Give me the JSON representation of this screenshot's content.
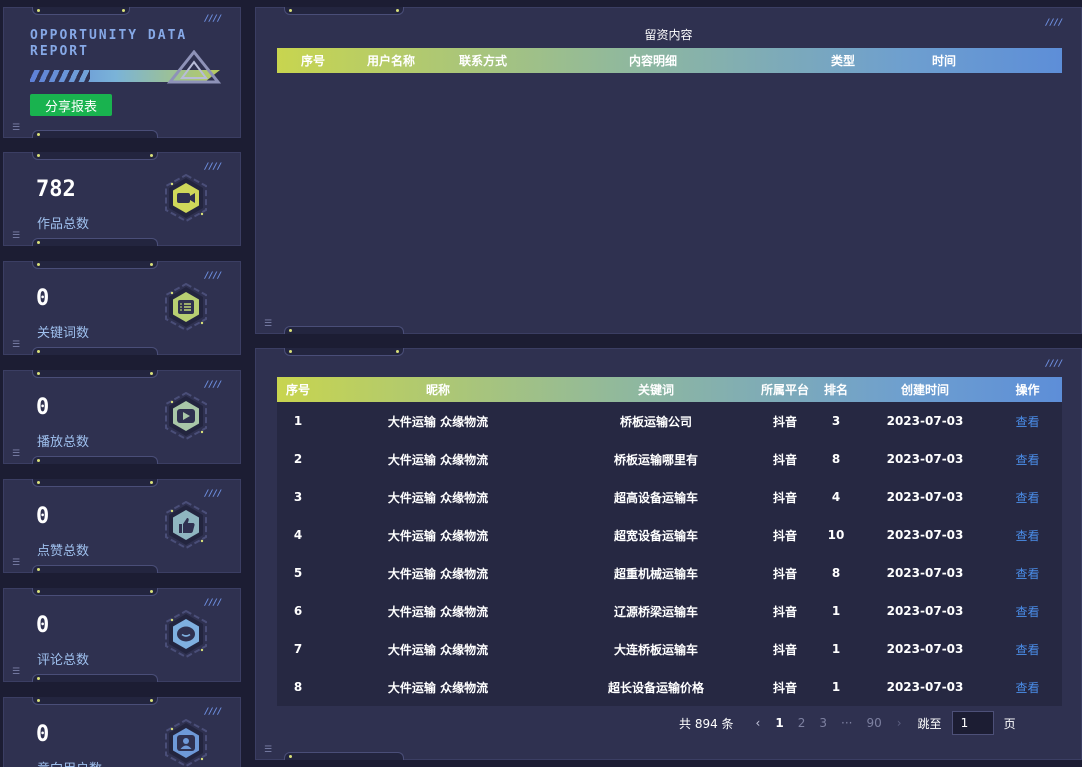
{
  "logo": {
    "line1": "OPPORTUNITY DATA",
    "line2": "REPORT",
    "share_label": "分享报表"
  },
  "stats": [
    {
      "value": "782",
      "label": "作品总数",
      "icon": "video-camera-icon"
    },
    {
      "value": "0",
      "label": "关键词数",
      "icon": "list-icon"
    },
    {
      "value": "0",
      "label": "播放总数",
      "icon": "play-icon"
    },
    {
      "value": "0",
      "label": "点赞总数",
      "icon": "thumbs-up-icon"
    },
    {
      "value": "0",
      "label": "评论总数",
      "icon": "comment-icon"
    },
    {
      "value": "0",
      "label": "意向用户数",
      "icon": "user-icon"
    }
  ],
  "leads_table": {
    "title": "留资内容",
    "columns": [
      "序号",
      "用户名称",
      "联系方式",
      "内容明细",
      "类型",
      "时间"
    ],
    "rows": []
  },
  "keywords_table": {
    "columns": [
      "序号",
      "昵称",
      "关键词",
      "所属平台",
      "排名",
      "创建时间",
      "操作"
    ],
    "rows": [
      {
        "index": "1",
        "nickname": "大件运输 众缘物流",
        "keyword": "桥板运输公司",
        "platform": "抖音",
        "rank": "3",
        "date": "2023-07-03",
        "action": "查看"
      },
      {
        "index": "2",
        "nickname": "大件运输 众缘物流",
        "keyword": "桥板运输哪里有",
        "platform": "抖音",
        "rank": "8",
        "date": "2023-07-03",
        "action": "查看"
      },
      {
        "index": "3",
        "nickname": "大件运输 众缘物流",
        "keyword": "超高设备运输车",
        "platform": "抖音",
        "rank": "4",
        "date": "2023-07-03",
        "action": "查看"
      },
      {
        "index": "4",
        "nickname": "大件运输 众缘物流",
        "keyword": "超宽设备运输车",
        "platform": "抖音",
        "rank": "10",
        "date": "2023-07-03",
        "action": "查看"
      },
      {
        "index": "5",
        "nickname": "大件运输 众缘物流",
        "keyword": "超重机械运输车",
        "platform": "抖音",
        "rank": "8",
        "date": "2023-07-03",
        "action": "查看"
      },
      {
        "index": "6",
        "nickname": "大件运输 众缘物流",
        "keyword": "辽源桥梁运输车",
        "platform": "抖音",
        "rank": "1",
        "date": "2023-07-03",
        "action": "查看"
      },
      {
        "index": "7",
        "nickname": "大件运输 众缘物流",
        "keyword": "大连桥板运输车",
        "platform": "抖音",
        "rank": "1",
        "date": "2023-07-03",
        "action": "查看"
      },
      {
        "index": "8",
        "nickname": "大件运输 众缘物流",
        "keyword": "超长设备运输价格",
        "platform": "抖音",
        "rank": "1",
        "date": "2023-07-03",
        "action": "查看"
      }
    ]
  },
  "pagination": {
    "total_text": "共 894 条",
    "prev": "‹",
    "pages": [
      "1",
      "2",
      "3",
      "···",
      "90"
    ],
    "current": "1",
    "next": "›",
    "jump_label": "跳至",
    "jump_value": "1",
    "page_unit": "页"
  },
  "colors": {
    "accent_green": "#19b34f",
    "link_blue": "#4a8de8",
    "header_gradient_start": "#c8d54f",
    "header_gradient_end": "#5d8ed8"
  }
}
